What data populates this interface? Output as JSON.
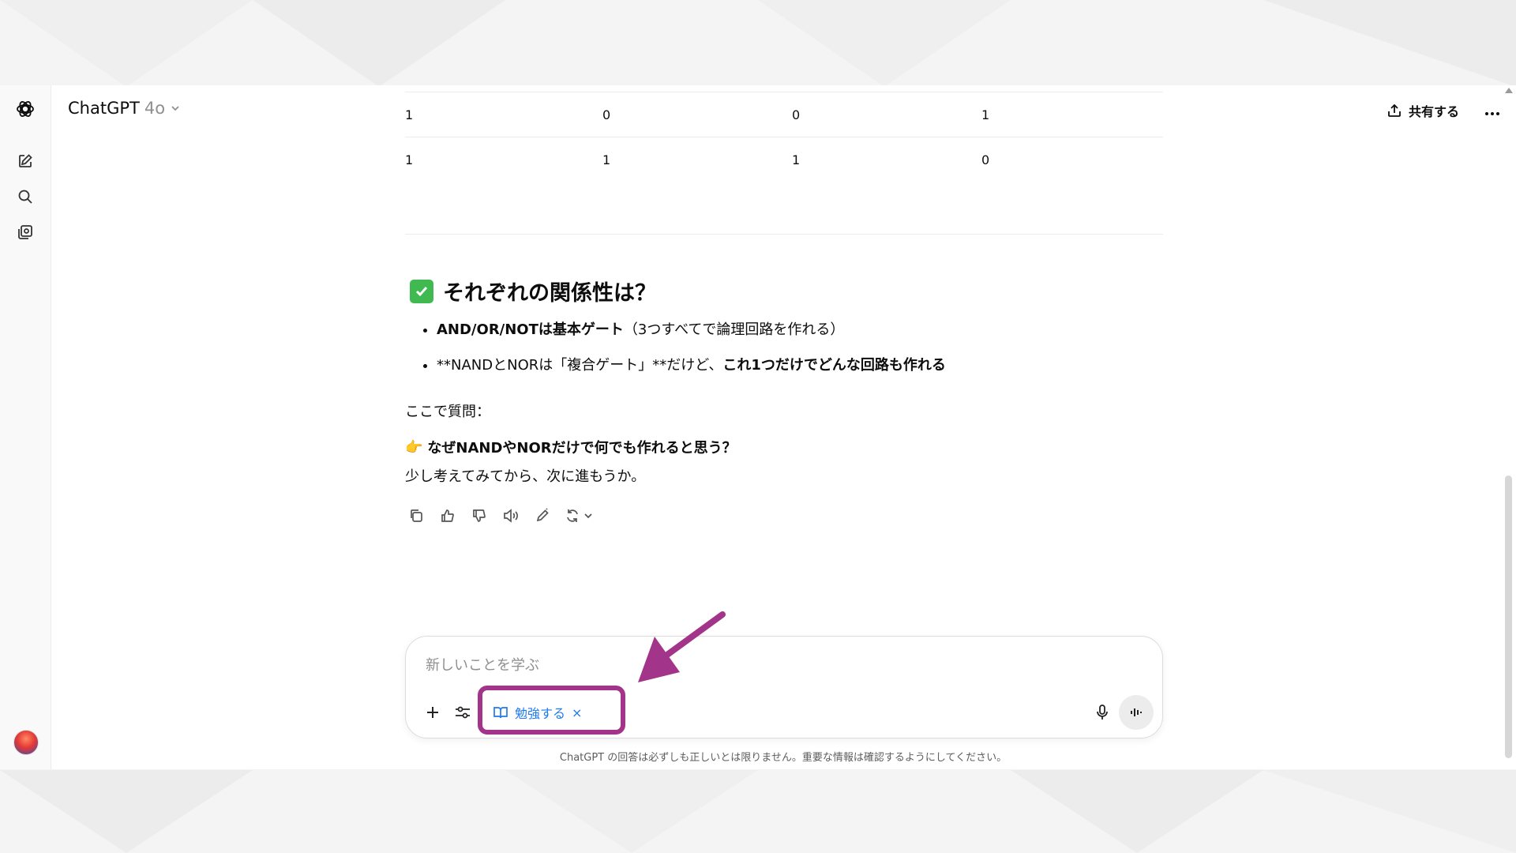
{
  "header": {
    "model_name": "ChatGPT",
    "model_version": "4o",
    "share_label": "共有する"
  },
  "sidebar": {
    "items": [
      {
        "name": "new-chat",
        "icon": "edit-icon"
      },
      {
        "name": "search",
        "icon": "search-icon"
      },
      {
        "name": "library",
        "icon": "library-icon"
      }
    ]
  },
  "table": {
    "rows": [
      [
        "1",
        "0",
        "0",
        "1"
      ],
      [
        "1",
        "1",
        "1",
        "0"
      ]
    ]
  },
  "message": {
    "heading": "それぞれの関係性は？",
    "bullet1_bold": "AND/OR/NOTは基本ゲート",
    "bullet1_rest": "（3つすべてで論理回路を作れる）",
    "bullet2_plain": "**NANDとNORは「複合ゲート」**だけど、",
    "bullet2_bold": "これ1つだけでどんな回路も作れる",
    "question_intro": "ここで質問：",
    "question_emoji": "👉",
    "question": "なぜNANDやNORだけで何でも作れると思う？",
    "followup": "少し考えてみてから、次に進もうか。"
  },
  "composer": {
    "placeholder": "新しいことを学ぶ",
    "study_chip_label": "勉強する",
    "study_chip_close": "×"
  },
  "disclaimer": "ChatGPT の回答は必ずしも正しいとは限りません。重要な情報は確認するようにしてください。",
  "colors": {
    "annotation": "#a23489",
    "study_chip": "#1f7aec",
    "check": "#3fb950"
  }
}
